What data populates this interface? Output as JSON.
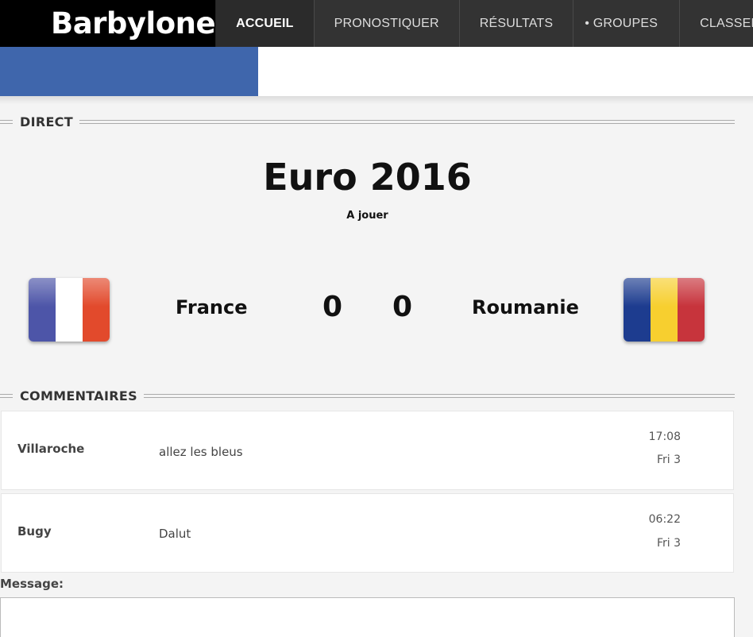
{
  "app": {
    "logo": "Barbylone"
  },
  "nav": {
    "items": [
      {
        "label": "ACCUEIL",
        "active": true
      },
      {
        "label": "PRONOSTIQUER",
        "active": false
      },
      {
        "label": "RÉSULTATS",
        "active": false
      },
      {
        "label": "• GROUPES",
        "active": false
      },
      {
        "label": "CLASSEMENT",
        "active": false
      }
    ]
  },
  "colors": {
    "header_blue": "#3f66ac",
    "nav_dark": "#333333",
    "logo_bg": "#000000"
  },
  "direct": {
    "heading": "DIRECT",
    "competition": "Euro 2016",
    "status": "A jouer",
    "home": {
      "name": "France",
      "score": "0",
      "flag_icon": "france-flag-icon"
    },
    "away": {
      "name": "Roumanie",
      "score": "0",
      "flag_icon": "romania-flag-icon"
    }
  },
  "comments": {
    "heading": "COMMENTAIRES",
    "items": [
      {
        "author": "Villaroche",
        "text": "allez les bleus",
        "time": "17:08",
        "date": "Fri 3"
      },
      {
        "author": "Bugy",
        "text": "Dalut",
        "time": "06:22",
        "date": "Fri 3"
      }
    ]
  },
  "message": {
    "label": "Message:",
    "value": ""
  }
}
